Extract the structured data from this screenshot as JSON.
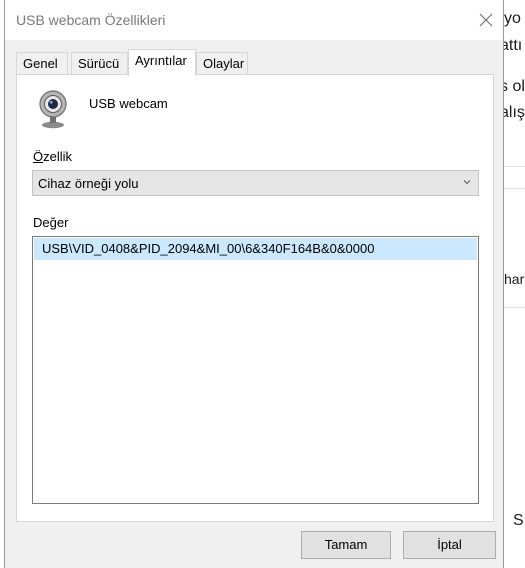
{
  "background_app": {
    "fragments": [
      "ıiyo",
      "attı",
      "s ol",
      "alış",
      "har",
      "S"
    ]
  },
  "dialog": {
    "title": "USB webcam Özellikleri",
    "close_icon": "close-icon",
    "tabs": [
      {
        "label": "Genel",
        "active": false
      },
      {
        "label": "Sürücü",
        "active": false
      },
      {
        "label": "Ayrıntılar",
        "active": true
      },
      {
        "label": "Olaylar",
        "active": false
      }
    ],
    "device": {
      "icon": "webcam-icon",
      "name": "USB webcam"
    },
    "property": {
      "label_underlined": "Ö",
      "label_rest": "zellik",
      "selected": "Cihaz örneği yolu"
    },
    "value": {
      "label_first": "De",
      "label_underlined": "ğ",
      "label_rest": "er",
      "items": [
        "USB\\VID_0408&PID_2094&MI_00\\6&340F164B&0&0000"
      ]
    },
    "buttons": {
      "ok": "Tamam",
      "cancel": "İptal"
    },
    "colors": {
      "selection": "#cce8ff",
      "dialog_bg": "#f0f0f0",
      "title_text": "#7a7a7a"
    }
  }
}
